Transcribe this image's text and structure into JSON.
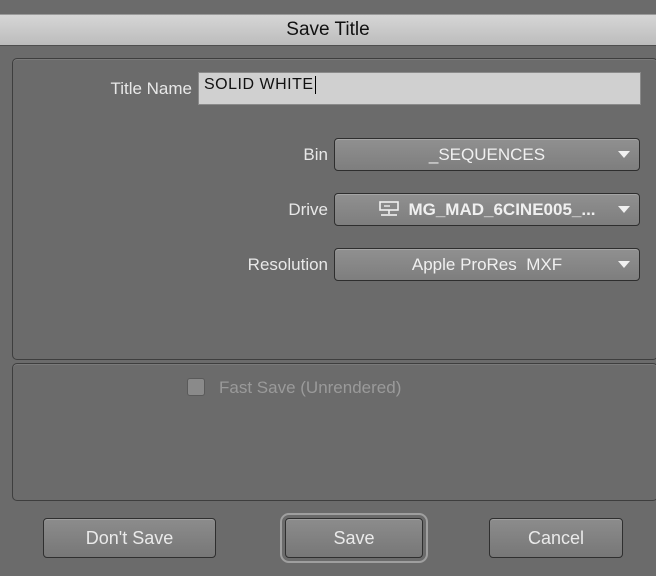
{
  "window": {
    "title": "Save Title"
  },
  "form": {
    "title_name_label": "Title Name",
    "title_name_value": "SOLID WHITE",
    "bin_label": "Bin",
    "bin_value": "_SEQUENCES",
    "drive_label": "Drive",
    "drive_value": "MG_MAD_6CINE005_...",
    "resolution_label": "Resolution",
    "resolution_value": "Apple ProRes  MXF"
  },
  "options": {
    "fast_save_label": "Fast Save (Unrendered)",
    "fast_save_checked": false
  },
  "buttons": {
    "dont_save": "Don't Save",
    "save": "Save",
    "cancel": "Cancel"
  },
  "icons": {
    "drive": "network-drive-icon",
    "dropdown": "triangle-down-icon"
  }
}
